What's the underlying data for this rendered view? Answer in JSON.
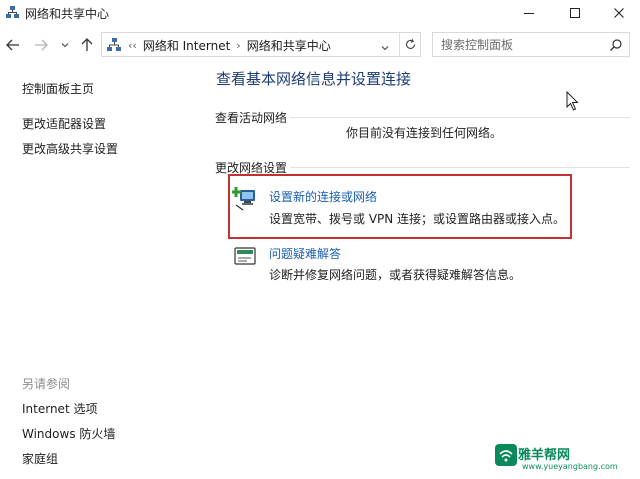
{
  "window": {
    "title": "网络和共享中心"
  },
  "address_bar": {
    "overflow": "‹‹",
    "crumbs": [
      "网络和 Internet",
      "网络和共享中心"
    ],
    "separator": "›"
  },
  "search": {
    "placeholder": "搜索控制面板"
  },
  "sidebar": {
    "home": "控制面板主页",
    "links": [
      "更改适配器设置",
      "更改高级共享设置"
    ],
    "see_also_heading": "另请参阅",
    "see_also": [
      "Internet 选项",
      "Windows 防火墙",
      "家庭组"
    ]
  },
  "main": {
    "title": "查看基本网络信息并设置连接",
    "active_networks": {
      "label": "查看活动网络",
      "status": "你目前没有连接到任何网络。"
    },
    "change_settings": {
      "label": "更改网络设置",
      "tasks": [
        {
          "icon": "new-connection-icon",
          "link": "设置新的连接或网络",
          "description": "设置宽带、拨号或 VPN 连接；或设置路由器或接入点。"
        },
        {
          "icon": "troubleshoot-icon",
          "link": "问题疑难解答",
          "description": "诊断并修复网络问题，或者获得疑难解答信息。"
        }
      ]
    }
  },
  "watermark": {
    "text": "雅羊帮网",
    "url": "www.yueyangbang.com"
  },
  "colors": {
    "link": "#1a5fb4",
    "title": "#1e3c78",
    "highlight": "#c0312f"
  }
}
